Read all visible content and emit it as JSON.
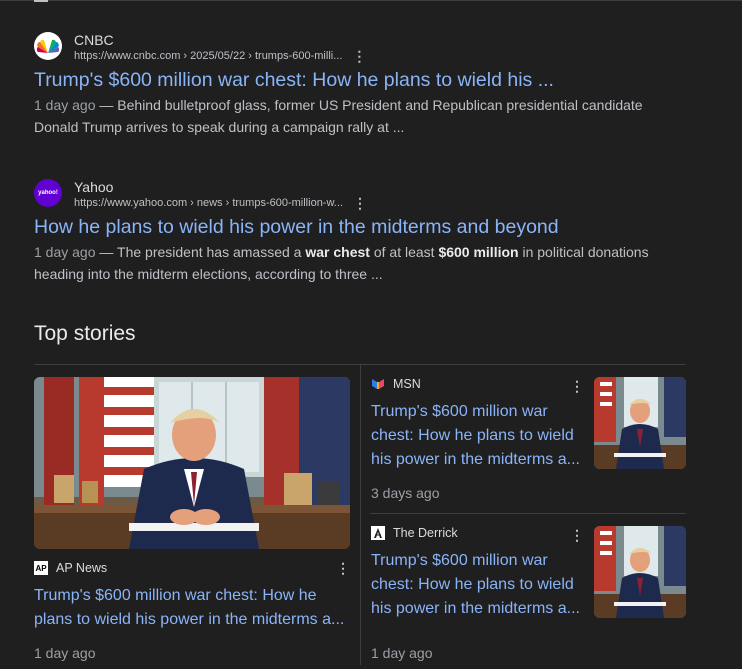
{
  "results": [
    {
      "source": "CNBC",
      "url": "https://www.cnbc.com › 2025/05/22 › trumps-600-milli...",
      "title": "Trump's $600 million war chest: How he plans to wield his ...",
      "date": "1 day ago",
      "snippet_pre": " — Behind bulletproof glass, former US President and Republican presidential candidate Donald Trump arrives to speak during a campaign rally at ...",
      "icon": "cnbc-peacock-icon"
    },
    {
      "source": "Yahoo",
      "url": "https://www.yahoo.com › news › trumps-600-million-w...",
      "title": "How he plans to wield his power in the midterms and beyond",
      "date": "1 day ago",
      "snippet_a": " — The president has amassed a ",
      "snippet_bold1": "war chest",
      "snippet_b": " of at least ",
      "snippet_bold2": "$600 million",
      "snippet_c": " in political donations heading into the midterm elections, according to three ...",
      "icon": "yahoo-icon",
      "icon_text": "yahoo!"
    }
  ],
  "top_stories": {
    "heading": "Top stories",
    "stories": [
      {
        "publisher": "AP News",
        "publisher_logo_text": "AP",
        "title": "Trump's $600 million war chest: How he plans to wield his power in the midterms a...",
        "date": "1 day ago"
      },
      {
        "publisher": "MSN",
        "title": "Trump's $600 million war chest: How he plans to wield his power in the midterms a...",
        "date": "3 days ago"
      },
      {
        "publisher": "The Derrick",
        "title": "Trump's $600 million war chest: How he plans to wield his power in the midterms a...",
        "date": "1 day ago"
      }
    ]
  },
  "more_icon": "⋮",
  "colors": {
    "background": "#1f1f1f",
    "link": "#8ab4f8",
    "text": "#bdc1c6",
    "divider": "#3c4043"
  }
}
